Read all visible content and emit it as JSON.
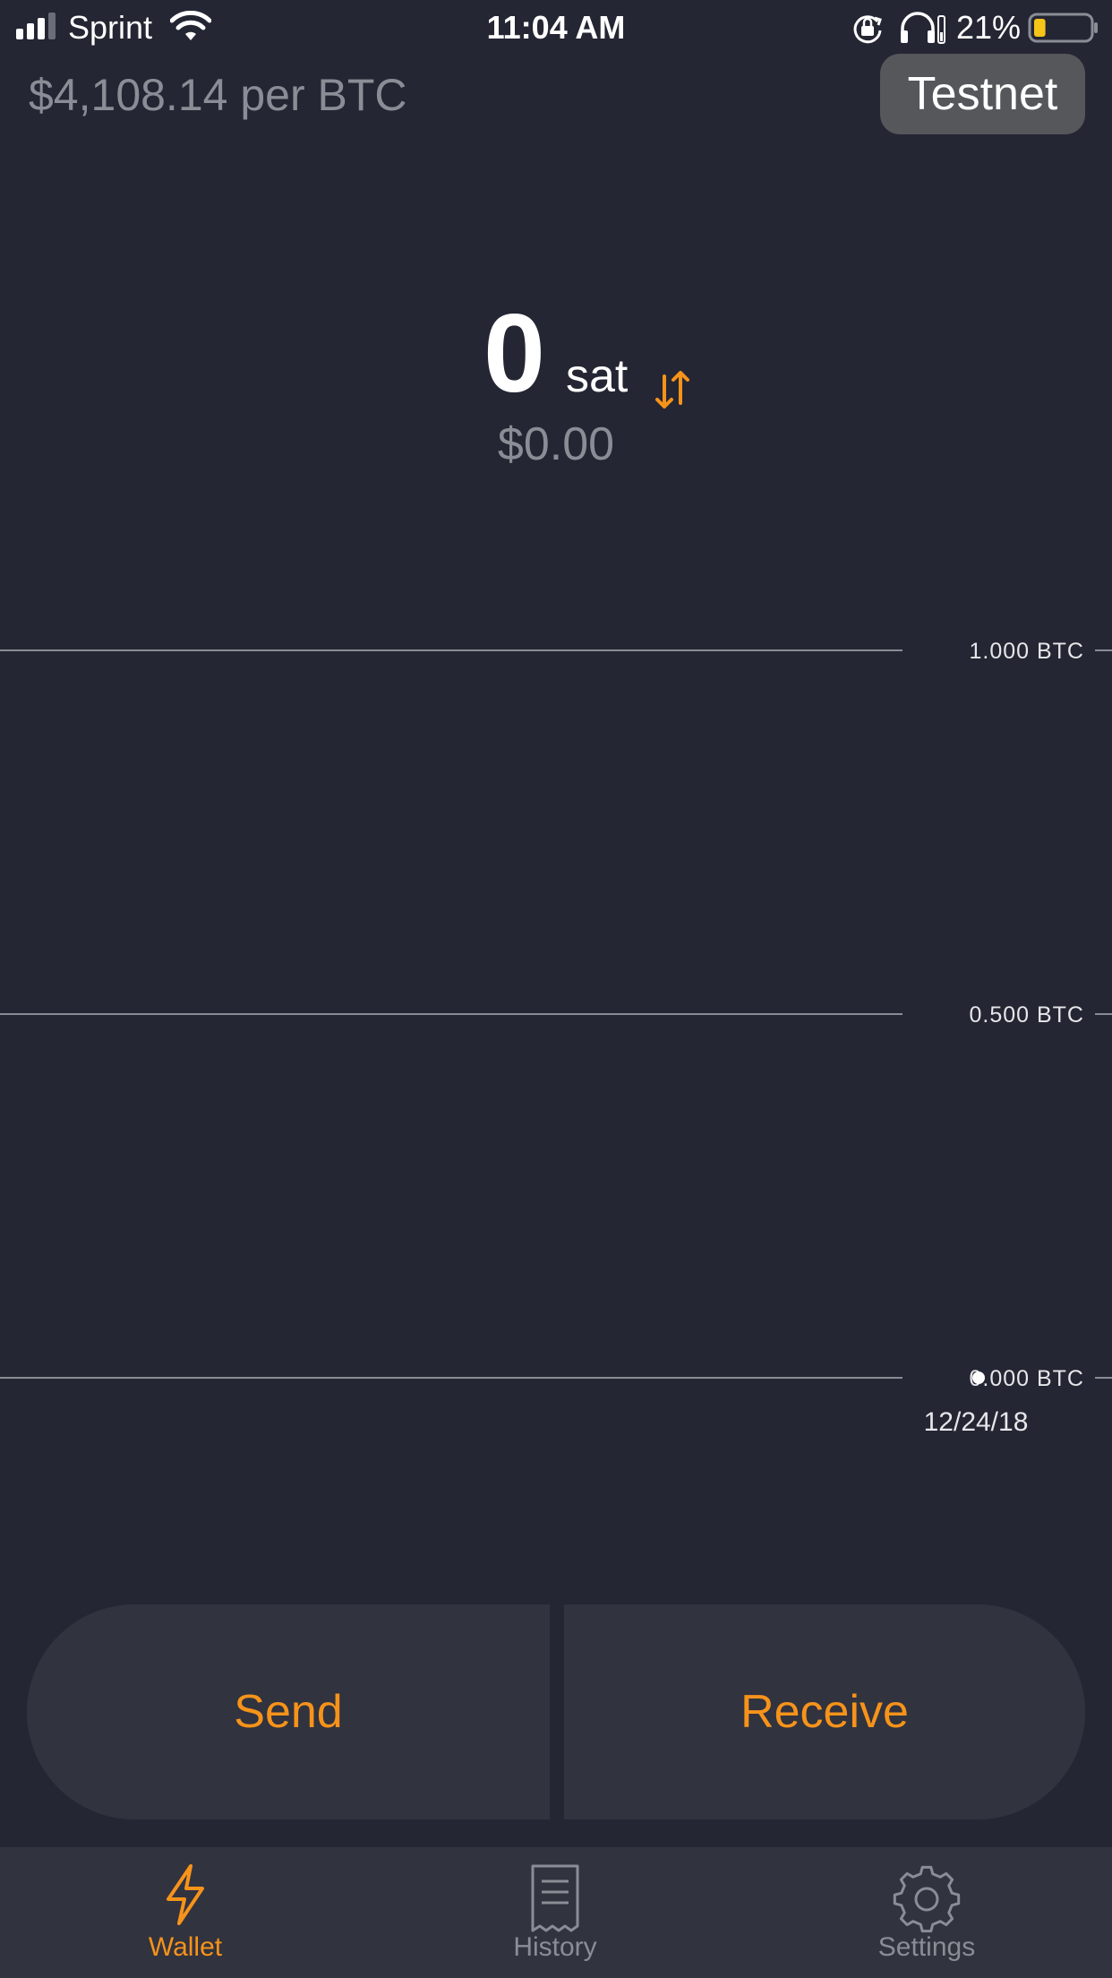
{
  "status_bar": {
    "carrier": "Sprint",
    "time": "11:04 AM",
    "battery_percent": "21%",
    "battery_level": 0.21,
    "signal_bars_filled": 3,
    "signal_bars_total": 4
  },
  "header": {
    "price": "$4,108.14 per BTC",
    "network_badge": "Testnet"
  },
  "balance": {
    "amount": "0",
    "unit": "sat",
    "fiat": "$0.00"
  },
  "chart_data": {
    "type": "line",
    "x": [
      "12/24/18"
    ],
    "series": [
      {
        "values": [
          0.0
        ]
      }
    ],
    "y_ticks": [
      "1.000 BTC",
      "0.500 BTC",
      "0.000 BTC"
    ],
    "y_tick_values": [
      1.0,
      0.5,
      0.0
    ],
    "x_tick_labels": [
      "12/24/18"
    ],
    "ylim": [
      0,
      1
    ],
    "grid": true
  },
  "actions": {
    "send_label": "Send",
    "receive_label": "Receive"
  },
  "tab_bar": {
    "tabs": [
      {
        "label": "Wallet",
        "icon": "lightning-icon",
        "active": true
      },
      {
        "label": "History",
        "icon": "receipt-icon",
        "active": false
      },
      {
        "label": "Settings",
        "icon": "gear-icon",
        "active": false
      }
    ]
  },
  "colors": {
    "background": "#242633",
    "surface": "#31333f",
    "accent": "#f7931a",
    "muted_text": "#8b8d96",
    "badge": "#56575b",
    "gridline": "#8a8c94"
  }
}
